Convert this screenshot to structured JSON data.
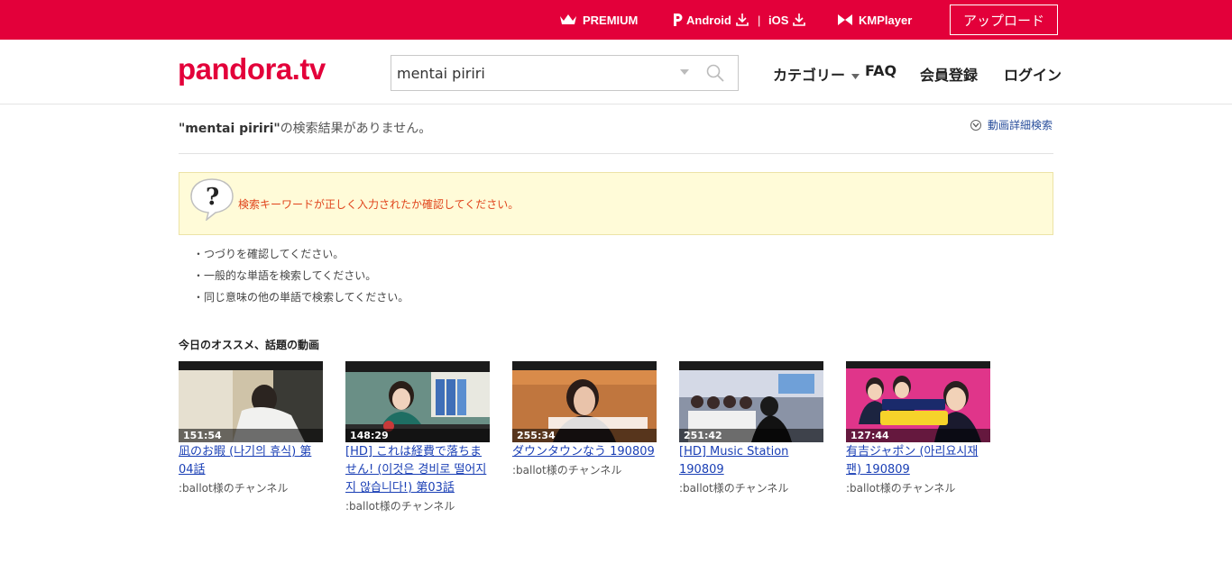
{
  "topbar": {
    "premium": "PREMIUM",
    "android": "Android",
    "ios": "iOS",
    "kmplayer": "KMPlayer",
    "upload": "アップロード",
    "brand_color": "#e3003a"
  },
  "header": {
    "logo": "pandora.tv",
    "search_value": "mentai piriri",
    "nav": {
      "category": "カテゴリー",
      "faq": "FAQ",
      "signup": "会員登録",
      "login": "ログイン"
    }
  },
  "results": {
    "query": "\"mentai piriri\"",
    "no_result_suffix": "の検索結果がありません。",
    "detail_search": "動画詳細検索",
    "notice": "検索キーワードが正しく入力されたか確認してください。",
    "tips": [
      "・つづりを確認してください。",
      "・一般的な単語を検索してください。",
      "・同じ意味の他の単語で検索してください。"
    ]
  },
  "recommend": {
    "title": "今日のオススメ、話題の動画",
    "videos": [
      {
        "duration": "151:54",
        "title": "凪のお暇 (나기의 휴식) 第04話",
        "channel": ":ballot様のチャンネル"
      },
      {
        "duration": "148:29",
        "title": "[HD] これは経費で落ちません! (이것은 경비로 떨어지지 않습니다!) 第03話",
        "channel": ":ballot様のチャンネル"
      },
      {
        "duration": "255:34",
        "title": "ダウンタウンなう 190809",
        "channel": ":ballot様のチャンネル"
      },
      {
        "duration": "251:42",
        "title": "[HD] Music Station 190809",
        "channel": ":ballot様のチャンネル"
      },
      {
        "duration": "127:44",
        "title": "有吉ジャポン (아리요시재팬) 190809",
        "channel": ":ballot様のチャンネル"
      }
    ]
  }
}
